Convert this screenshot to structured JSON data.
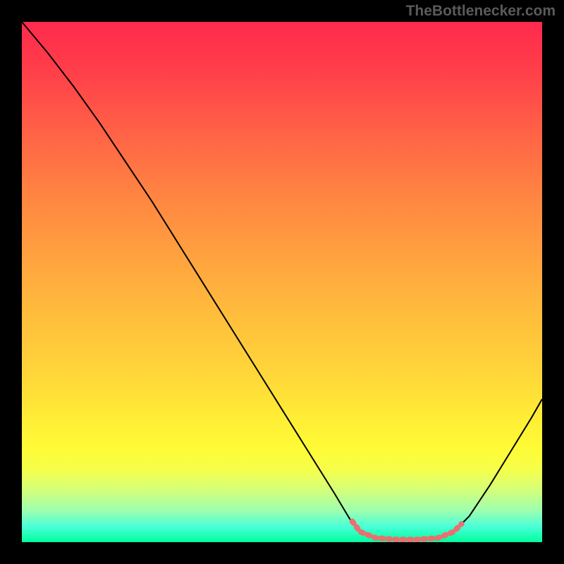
{
  "watermark": "TheBottlenecker.com",
  "chart_data": {
    "type": "line",
    "title": "",
    "xlabel": "",
    "ylabel": "",
    "xlim": [
      0,
      100
    ],
    "ylim": [
      0,
      100
    ],
    "gradient_description": "vertical gradient red (high y) to green (low y)",
    "series": [
      {
        "name": "bottleneck-curve",
        "color": "#000000",
        "points": [
          {
            "x": 0.0,
            "y": 100.0
          },
          {
            "x": 5.0,
            "y": 94.0
          },
          {
            "x": 10.0,
            "y": 87.5
          },
          {
            "x": 15.0,
            "y": 80.5
          },
          {
            "x": 20.0,
            "y": 73.0
          },
          {
            "x": 25.0,
            "y": 65.5
          },
          {
            "x": 30.0,
            "y": 57.5
          },
          {
            "x": 35.0,
            "y": 49.5
          },
          {
            "x": 40.0,
            "y": 41.5
          },
          {
            "x": 45.0,
            "y": 33.5
          },
          {
            "x": 50.0,
            "y": 25.5
          },
          {
            "x": 55.0,
            "y": 17.5
          },
          {
            "x": 60.0,
            "y": 9.5
          },
          {
            "x": 63.0,
            "y": 4.5
          },
          {
            "x": 65.0,
            "y": 2.0
          },
          {
            "x": 68.0,
            "y": 0.8
          },
          {
            "x": 72.0,
            "y": 0.5
          },
          {
            "x": 76.0,
            "y": 0.5
          },
          {
            "x": 80.0,
            "y": 0.8
          },
          {
            "x": 83.0,
            "y": 2.0
          },
          {
            "x": 86.0,
            "y": 5.0
          },
          {
            "x": 90.0,
            "y": 11.0
          },
          {
            "x": 94.0,
            "y": 17.5
          },
          {
            "x": 98.0,
            "y": 24.0
          },
          {
            "x": 100.0,
            "y": 27.5
          }
        ]
      },
      {
        "name": "optimal-zone-highlight",
        "color": "#e87070",
        "stroke_width": 6,
        "points": [
          {
            "x": 63.5,
            "y": 4.0
          },
          {
            "x": 65.0,
            "y": 2.0
          },
          {
            "x": 68.0,
            "y": 0.8
          },
          {
            "x": 72.0,
            "y": 0.5
          },
          {
            "x": 76.0,
            "y": 0.5
          },
          {
            "x": 80.0,
            "y": 0.8
          },
          {
            "x": 83.0,
            "y": 2.0
          },
          {
            "x": 84.5,
            "y": 3.5
          }
        ]
      }
    ]
  }
}
